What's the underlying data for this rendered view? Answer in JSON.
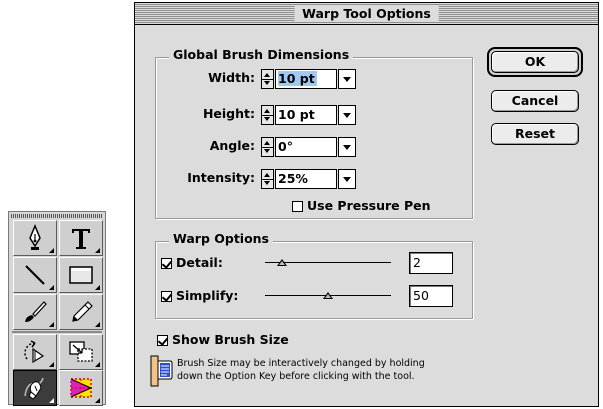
{
  "dialog": {
    "title": "Warp Tool Options",
    "buttons": {
      "ok": "OK",
      "cancel": "Cancel",
      "reset": "Reset"
    }
  },
  "global_brush": {
    "title": "Global Brush Dimensions",
    "fields": {
      "width": {
        "label": "Width:",
        "value": "10 pt"
      },
      "height": {
        "label": "Height:",
        "value": "10 pt"
      },
      "angle": {
        "label": "Angle:",
        "value": "0°"
      },
      "intensity": {
        "label": "Intensity:",
        "value": "25%"
      }
    },
    "pressure_pen": {
      "label": "Use Pressure Pen",
      "checked": false
    }
  },
  "warp_options": {
    "title": "Warp Options",
    "detail": {
      "label": "Detail:",
      "checked": true,
      "value": "2",
      "slider_level": 0.13
    },
    "simplify": {
      "label": "Simplify:",
      "checked": true,
      "value": "50",
      "slider_level": 0.5
    }
  },
  "show_brush_size": {
    "label": "Show Brush Size",
    "checked": true
  },
  "info": {
    "icon": "help-balloon-icon",
    "line1": "Brush Size may be interactively changed by holding",
    "line2": "down the Option Key before clicking with the tool."
  },
  "toolbox": {
    "tools": [
      "pen-icon",
      "type-icon",
      "line-icon",
      "rectangle-icon",
      "paintbrush-icon",
      "pencil-icon",
      "rotate-icon",
      "scale-icon",
      "warp-icon",
      "gradient-mesh-icon"
    ]
  }
}
